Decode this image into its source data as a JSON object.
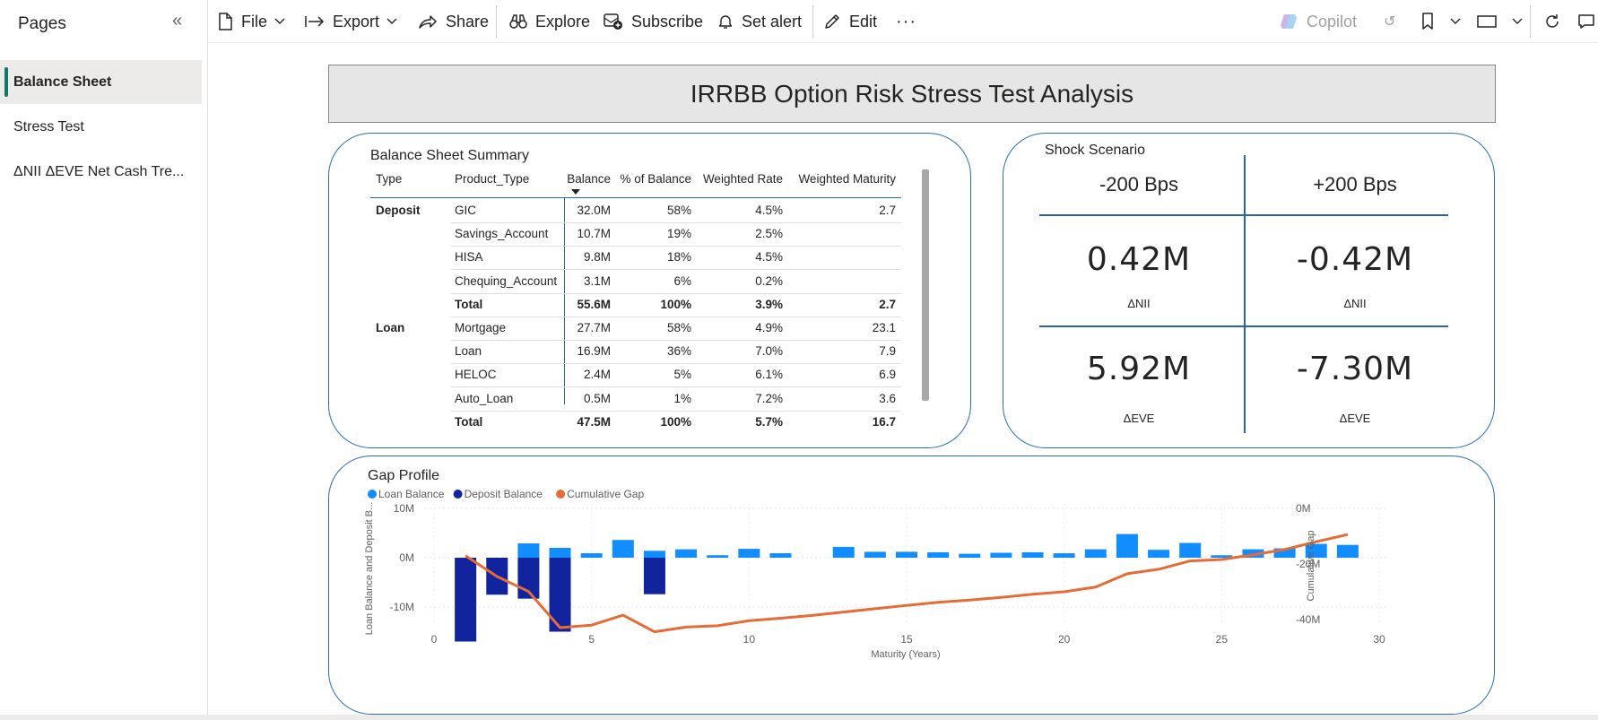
{
  "sidebar": {
    "title": "Pages",
    "collapse_icon": "double-chevron-left-icon",
    "pages": [
      {
        "label": "Balance Sheet",
        "active": true
      },
      {
        "label": "Stress Test",
        "active": false
      },
      {
        "label": "ΔNII ΔEVE Net Cash Tre...",
        "active": false
      }
    ]
  },
  "toolbar": {
    "file": "File",
    "export": "Export",
    "share": "Share",
    "explore": "Explore",
    "subscribe": "Subscribe",
    "set_alert": "Set alert",
    "edit": "Edit",
    "more": "···",
    "copilot": "Copilot"
  },
  "report": {
    "title": "IRRBB Option Risk Stress Test Analysis"
  },
  "balance_sheet": {
    "title": "Balance Sheet Summary",
    "columns": [
      "Type",
      "Product_Type",
      "Balance",
      "% of Balance",
      "Weighted Rate",
      "Weighted Maturity"
    ],
    "rows": [
      {
        "type": "Deposit",
        "product": "GIC",
        "balance": "32.0M",
        "pct": "58%",
        "rate": "4.5%",
        "maturity": "2.7"
      },
      {
        "type": "",
        "product": "Savings_Account",
        "balance": "10.7M",
        "pct": "19%",
        "rate": "2.5%",
        "maturity": ""
      },
      {
        "type": "",
        "product": "HISA",
        "balance": "9.8M",
        "pct": "18%",
        "rate": "4.5%",
        "maturity": ""
      },
      {
        "type": "",
        "product": "Chequing_Account",
        "balance": "3.1M",
        "pct": "6%",
        "rate": "0.2%",
        "maturity": ""
      },
      {
        "type": "",
        "product": "Total",
        "balance": "55.6M",
        "pct": "100%",
        "rate": "3.9%",
        "maturity": "2.7",
        "total": true
      },
      {
        "type": "Loan",
        "product": "Mortgage",
        "balance": "27.7M",
        "pct": "58%",
        "rate": "4.9%",
        "maturity": "23.1"
      },
      {
        "type": "",
        "product": "Loan",
        "balance": "16.9M",
        "pct": "36%",
        "rate": "7.0%",
        "maturity": "7.9"
      },
      {
        "type": "",
        "product": "HELOC",
        "balance": "2.4M",
        "pct": "5%",
        "rate": "6.1%",
        "maturity": "6.9"
      },
      {
        "type": "",
        "product": "Auto_Loan",
        "balance": "0.5M",
        "pct": "1%",
        "rate": "7.2%",
        "maturity": "3.6"
      },
      {
        "type": "",
        "product": "Total",
        "balance": "47.5M",
        "pct": "100%",
        "rate": "5.7%",
        "maturity": "16.7",
        "total": true
      }
    ]
  },
  "shock": {
    "title": "Shock Scenario",
    "down_header": "-200 Bps",
    "up_header": "+200 Bps",
    "nii_down": "0.42M",
    "nii_up": "-0.42M",
    "nii_label": "ΔNII",
    "eve_down": "5.92M",
    "eve_up": "-7.30M",
    "eve_label": "ΔEVE"
  },
  "gap": {
    "title": "Gap Profile",
    "colors": {
      "loan": "#118dff",
      "deposit": "#12239e",
      "cumulative": "#e66c37"
    }
  },
  "chart_data": {
    "type": "bar",
    "title": "Gap Profile",
    "xlabel": "Maturity (Years)",
    "ylabel": "Loan Balance and Deposit B...",
    "y2label": "Cumulative Gap",
    "xlim": [
      0,
      30
    ],
    "ylim": [
      -15,
      10
    ],
    "y2lim": [
      -45,
      0
    ],
    "x_ticks": [
      "0",
      "5",
      "10",
      "15",
      "20",
      "25",
      "30"
    ],
    "y_ticks": [
      "10M",
      "0M",
      "-10M"
    ],
    "y2_ticks": [
      "0M",
      "-20M",
      "-40M"
    ],
    "legend": [
      "Loan Balance",
      "Deposit Balance",
      "Cumulative Gap"
    ],
    "legend_position": "top-left",
    "grid": true,
    "x": [
      1,
      2,
      3,
      4,
      5,
      6,
      7,
      8,
      9,
      10,
      11,
      12,
      13,
      14,
      15,
      16,
      17,
      18,
      19,
      20,
      21,
      22,
      23,
      24,
      25,
      26,
      27,
      28,
      29
    ],
    "series": [
      {
        "name": "Loan Balance",
        "values": [
          0,
          0,
          2.9,
          2.0,
          0.9,
          3.6,
          1.4,
          1.7,
          0.5,
          1.8,
          0.9,
          0,
          2.2,
          1.2,
          1.2,
          1.1,
          0.8,
          1.0,
          1.1,
          0.9,
          1.7,
          4.8,
          1.6,
          3.0,
          0.5,
          1.7,
          1.9,
          2.8,
          2.6
        ]
      },
      {
        "name": "Deposit Balance",
        "values": [
          -17.0,
          -7.5,
          -8.3,
          -15.0,
          0,
          0,
          -7.4,
          0,
          0,
          0,
          0,
          0,
          0,
          0,
          0,
          0,
          0,
          0,
          0,
          0,
          0,
          0,
          0,
          0,
          0,
          0,
          0,
          0,
          0
        ]
      },
      {
        "name": "Cumulative Gap",
        "type": "line",
        "values": [
          -17.0,
          -24.5,
          -29.9,
          -42.9,
          -42.0,
          -38.4,
          -44.4,
          -42.7,
          -42.2,
          -40.4,
          -39.5,
          -38.5,
          -37.3,
          -36.1,
          -34.9,
          -33.8,
          -33.0,
          -32.0,
          -30.9,
          -30.0,
          -28.3,
          -23.5,
          -21.9,
          -18.9,
          -18.4,
          -16.7,
          -14.8,
          -12.0,
          -9.4
        ]
      }
    ]
  }
}
